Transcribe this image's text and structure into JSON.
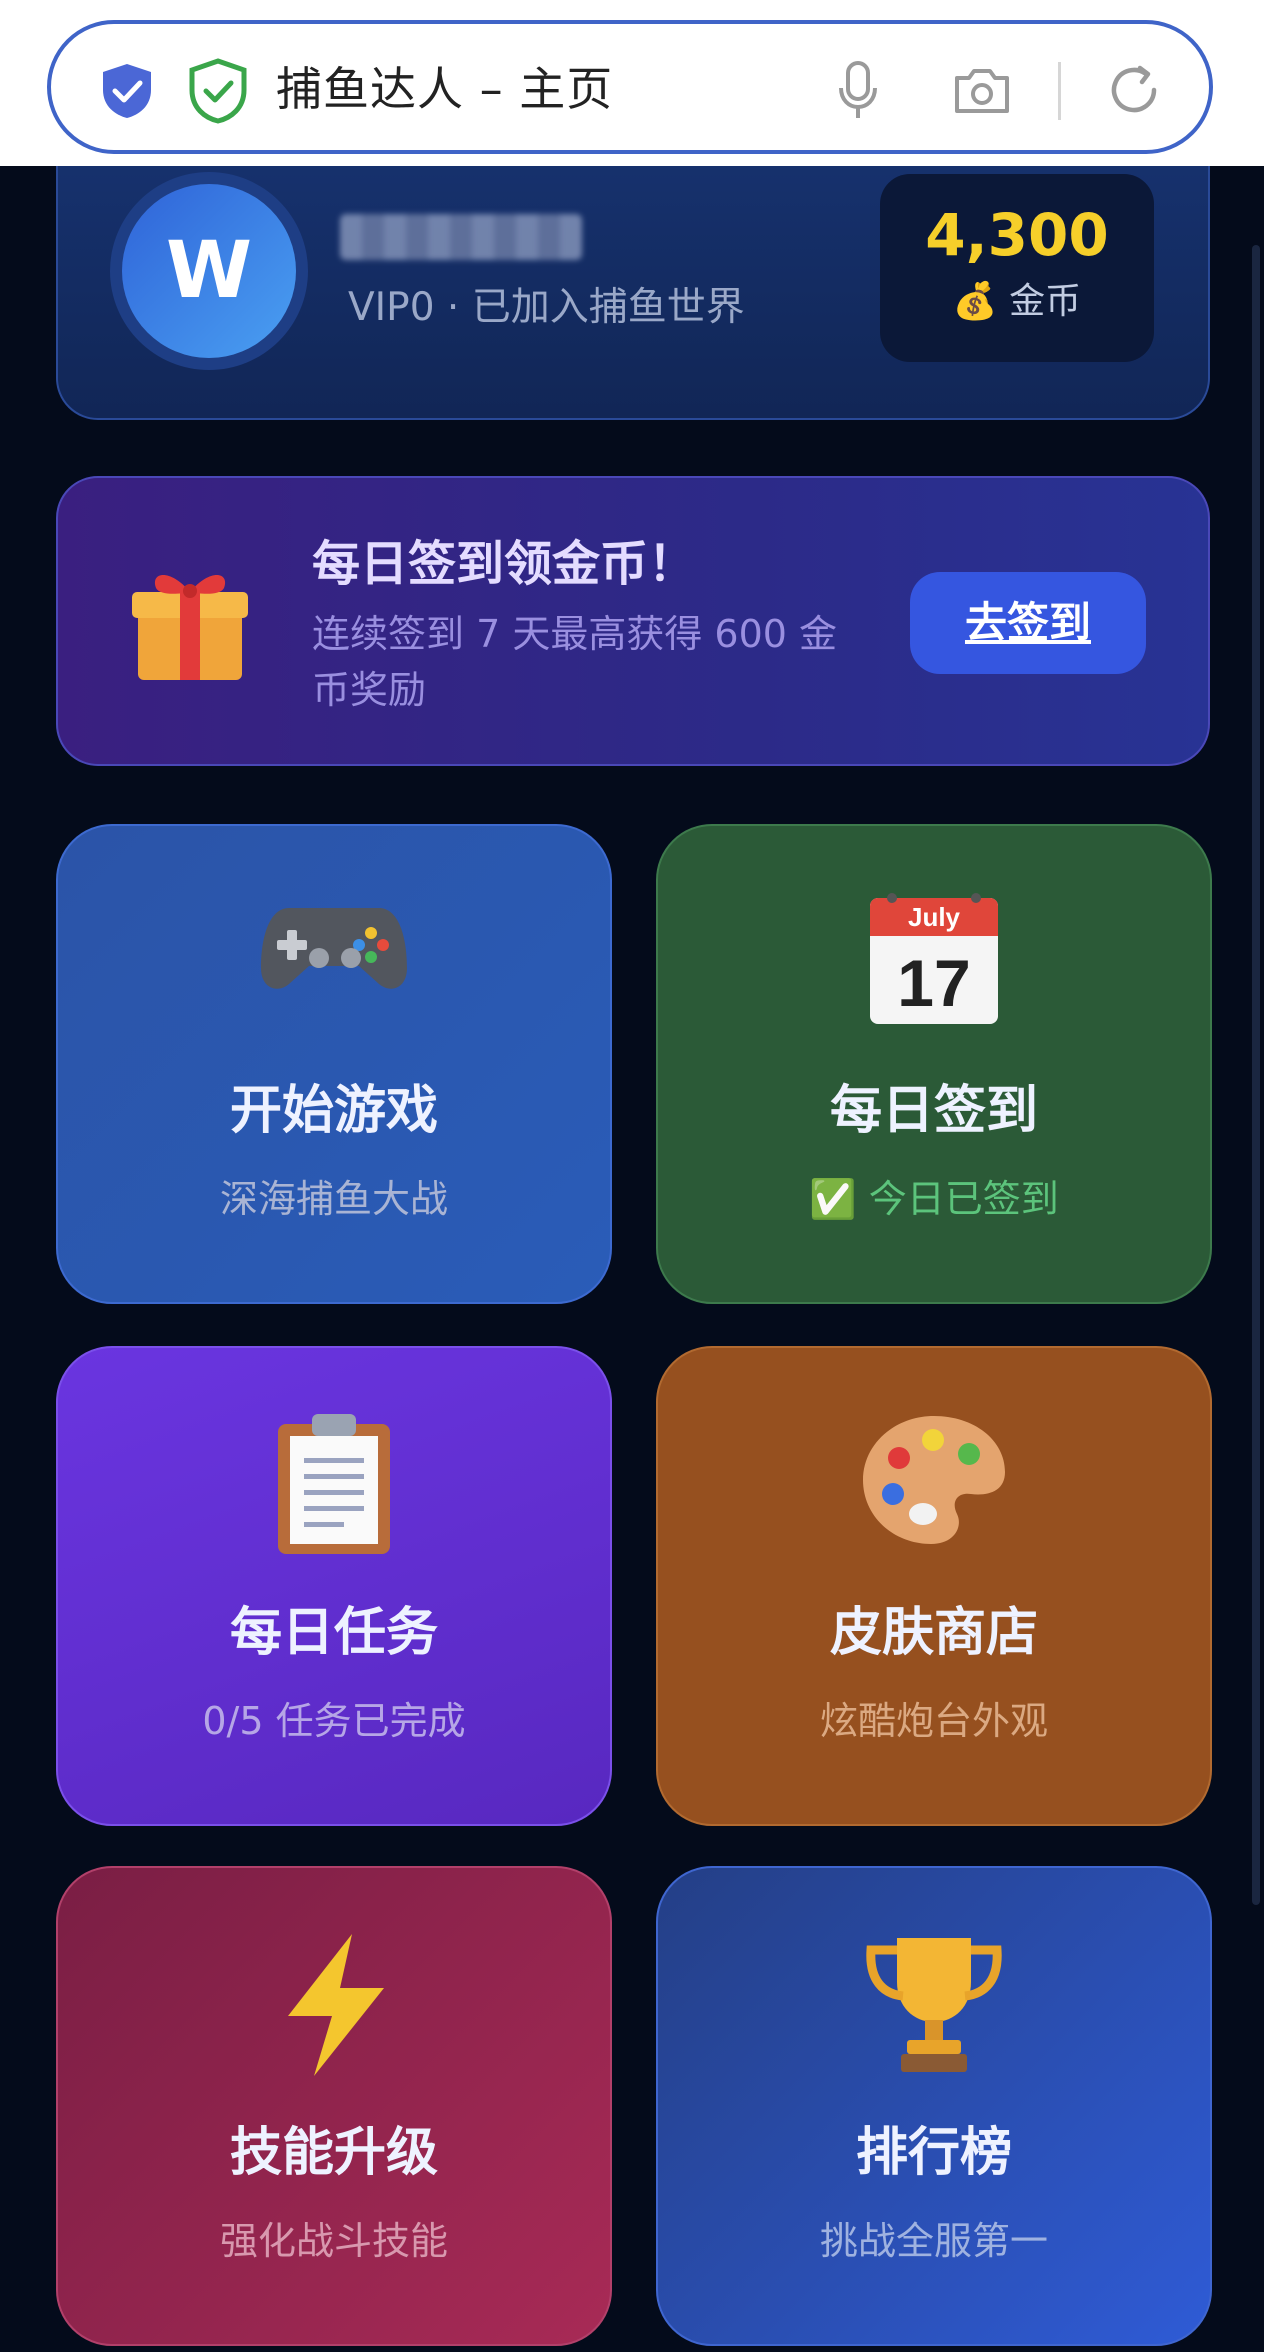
{
  "browser": {
    "page_title": "捕鱼达人 – 主页",
    "icons": [
      "shield-icon",
      "secure-check-icon",
      "microphone-icon",
      "camera-icon",
      "reload-icon"
    ]
  },
  "profile": {
    "avatar_letter": "W",
    "status_line": "VIP0 · 已加入捕鱼世界",
    "coins": "4,300",
    "coins_label": "💰 金币"
  },
  "checkin_banner": {
    "title": "每日签到领金币！",
    "subtitle": "连续签到 7 天最高获得 600 金币奖励",
    "button_label": "去签到",
    "icon": "gift-icon"
  },
  "cards": [
    {
      "title": "开始游戏",
      "subtitle": "深海捕鱼大战",
      "icon": "gamepad-icon",
      "color": "#2b56ac"
    },
    {
      "title": "每日签到",
      "subtitle": "✅ 今日已签到",
      "icon": "calendar-icon",
      "calendar_month": "July",
      "calendar_day": "17",
      "color": "#2b5a37"
    },
    {
      "title": "每日任务",
      "subtitle": "0/5 任务已完成",
      "icon": "clipboard-icon",
      "color": "#6230d2"
    },
    {
      "title": "皮肤商店",
      "subtitle": "炫酷炮台外观",
      "icon": "palette-icon",
      "color": "#96501f"
    },
    {
      "title": "技能升级",
      "subtitle": "强化战斗技能",
      "icon": "lightning-icon",
      "color": "#8e244c"
    },
    {
      "title": "排行榜",
      "subtitle": "挑战全服第一",
      "icon": "trophy-icon",
      "color": "#2a4aa8"
    }
  ]
}
